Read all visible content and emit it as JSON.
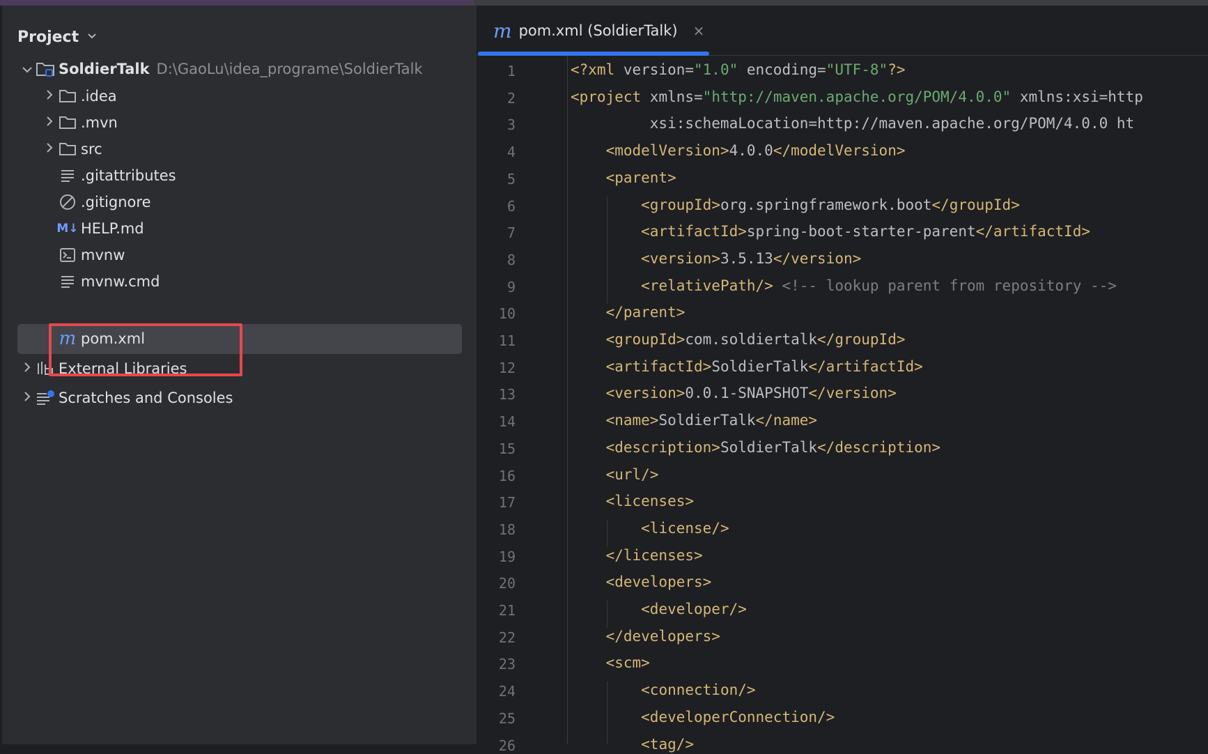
{
  "project_panel": {
    "title": "Project",
    "root": {
      "name": "SoldierTalk",
      "path": "D:\\GaoLu\\idea_programe\\SoldierTalk"
    },
    "items": [
      {
        "label": ".idea",
        "icon": "folder-icon",
        "expandable": true
      },
      {
        "label": ".mvn",
        "icon": "folder-icon",
        "expandable": true
      },
      {
        "label": "src",
        "icon": "folder-icon",
        "expandable": true
      },
      {
        "label": ".gitattributes",
        "icon": "text-file-icon",
        "expandable": false
      },
      {
        "label": ".gitignore",
        "icon": "ignore-file-icon",
        "expandable": false
      },
      {
        "label": "HELP.md",
        "icon": "markdown-icon",
        "icon_text": "M↓",
        "expandable": false
      },
      {
        "label": "mvnw",
        "icon": "terminal-icon",
        "expandable": false
      },
      {
        "label": "mvnw.cmd",
        "icon": "text-file-icon",
        "expandable": false
      },
      {
        "label": "pom.xml",
        "icon": "maven-icon",
        "icon_text": "m",
        "expandable": false,
        "selected": true
      }
    ],
    "bottom_items": [
      {
        "label": "External Libraries",
        "icon": "libraries-icon"
      },
      {
        "label": "Scratches and Consoles",
        "icon": "scratches-icon"
      }
    ]
  },
  "editor": {
    "tab": {
      "label": "pom.xml (SoldierTalk)",
      "icon_text": "m",
      "close": "×"
    },
    "line_numbers": [
      "1",
      "2",
      "3",
      "4",
      "5",
      "6",
      "7",
      "8",
      "9",
      "10",
      "11",
      "12",
      "13",
      "14",
      "15",
      "16",
      "17",
      "18",
      "19",
      "20",
      "21",
      "22",
      "23",
      "24",
      "25",
      "26"
    ],
    "lines": [
      "<?xml version=\"1.0\" encoding=\"UTF-8\"?>",
      "<project xmlns=\"http://maven.apache.org/POM/4.0.0\" xmlns:xsi=\"http",
      "         xsi:schemaLocation=\"http://maven.apache.org/POM/4.0.0 ht",
      "    <modelVersion>4.0.0</modelVersion>",
      "    <parent>",
      "        <groupId>org.springframework.boot</groupId>",
      "        <artifactId>spring-boot-starter-parent</artifactId>",
      "        <version>3.5.13</version>",
      "        <relativePath/> <!-- lookup parent from repository -->",
      "    </parent>",
      "    <groupId>com.soldiertalk</groupId>",
      "    <artifactId>SoldierTalk</artifactId>",
      "    <version>0.0.1-SNAPSHOT</version>",
      "    <name>SoldierTalk</name>",
      "    <description>SoldierTalk</description>",
      "    <url/>",
      "    <licenses>",
      "        <license/>",
      "    </licenses>",
      "    <developers>",
      "        <developer/>",
      "    </developers>",
      "    <scm>",
      "        <connection/>",
      "        <developerConnection/>",
      "        <tag/>"
    ]
  },
  "colors": {
    "tag": "#d5b778",
    "value": "#6aab73",
    "namespace": "#c77dbb",
    "comment": "#7a7e85",
    "accent": "#3574f0",
    "highlight": "#e5484d"
  }
}
